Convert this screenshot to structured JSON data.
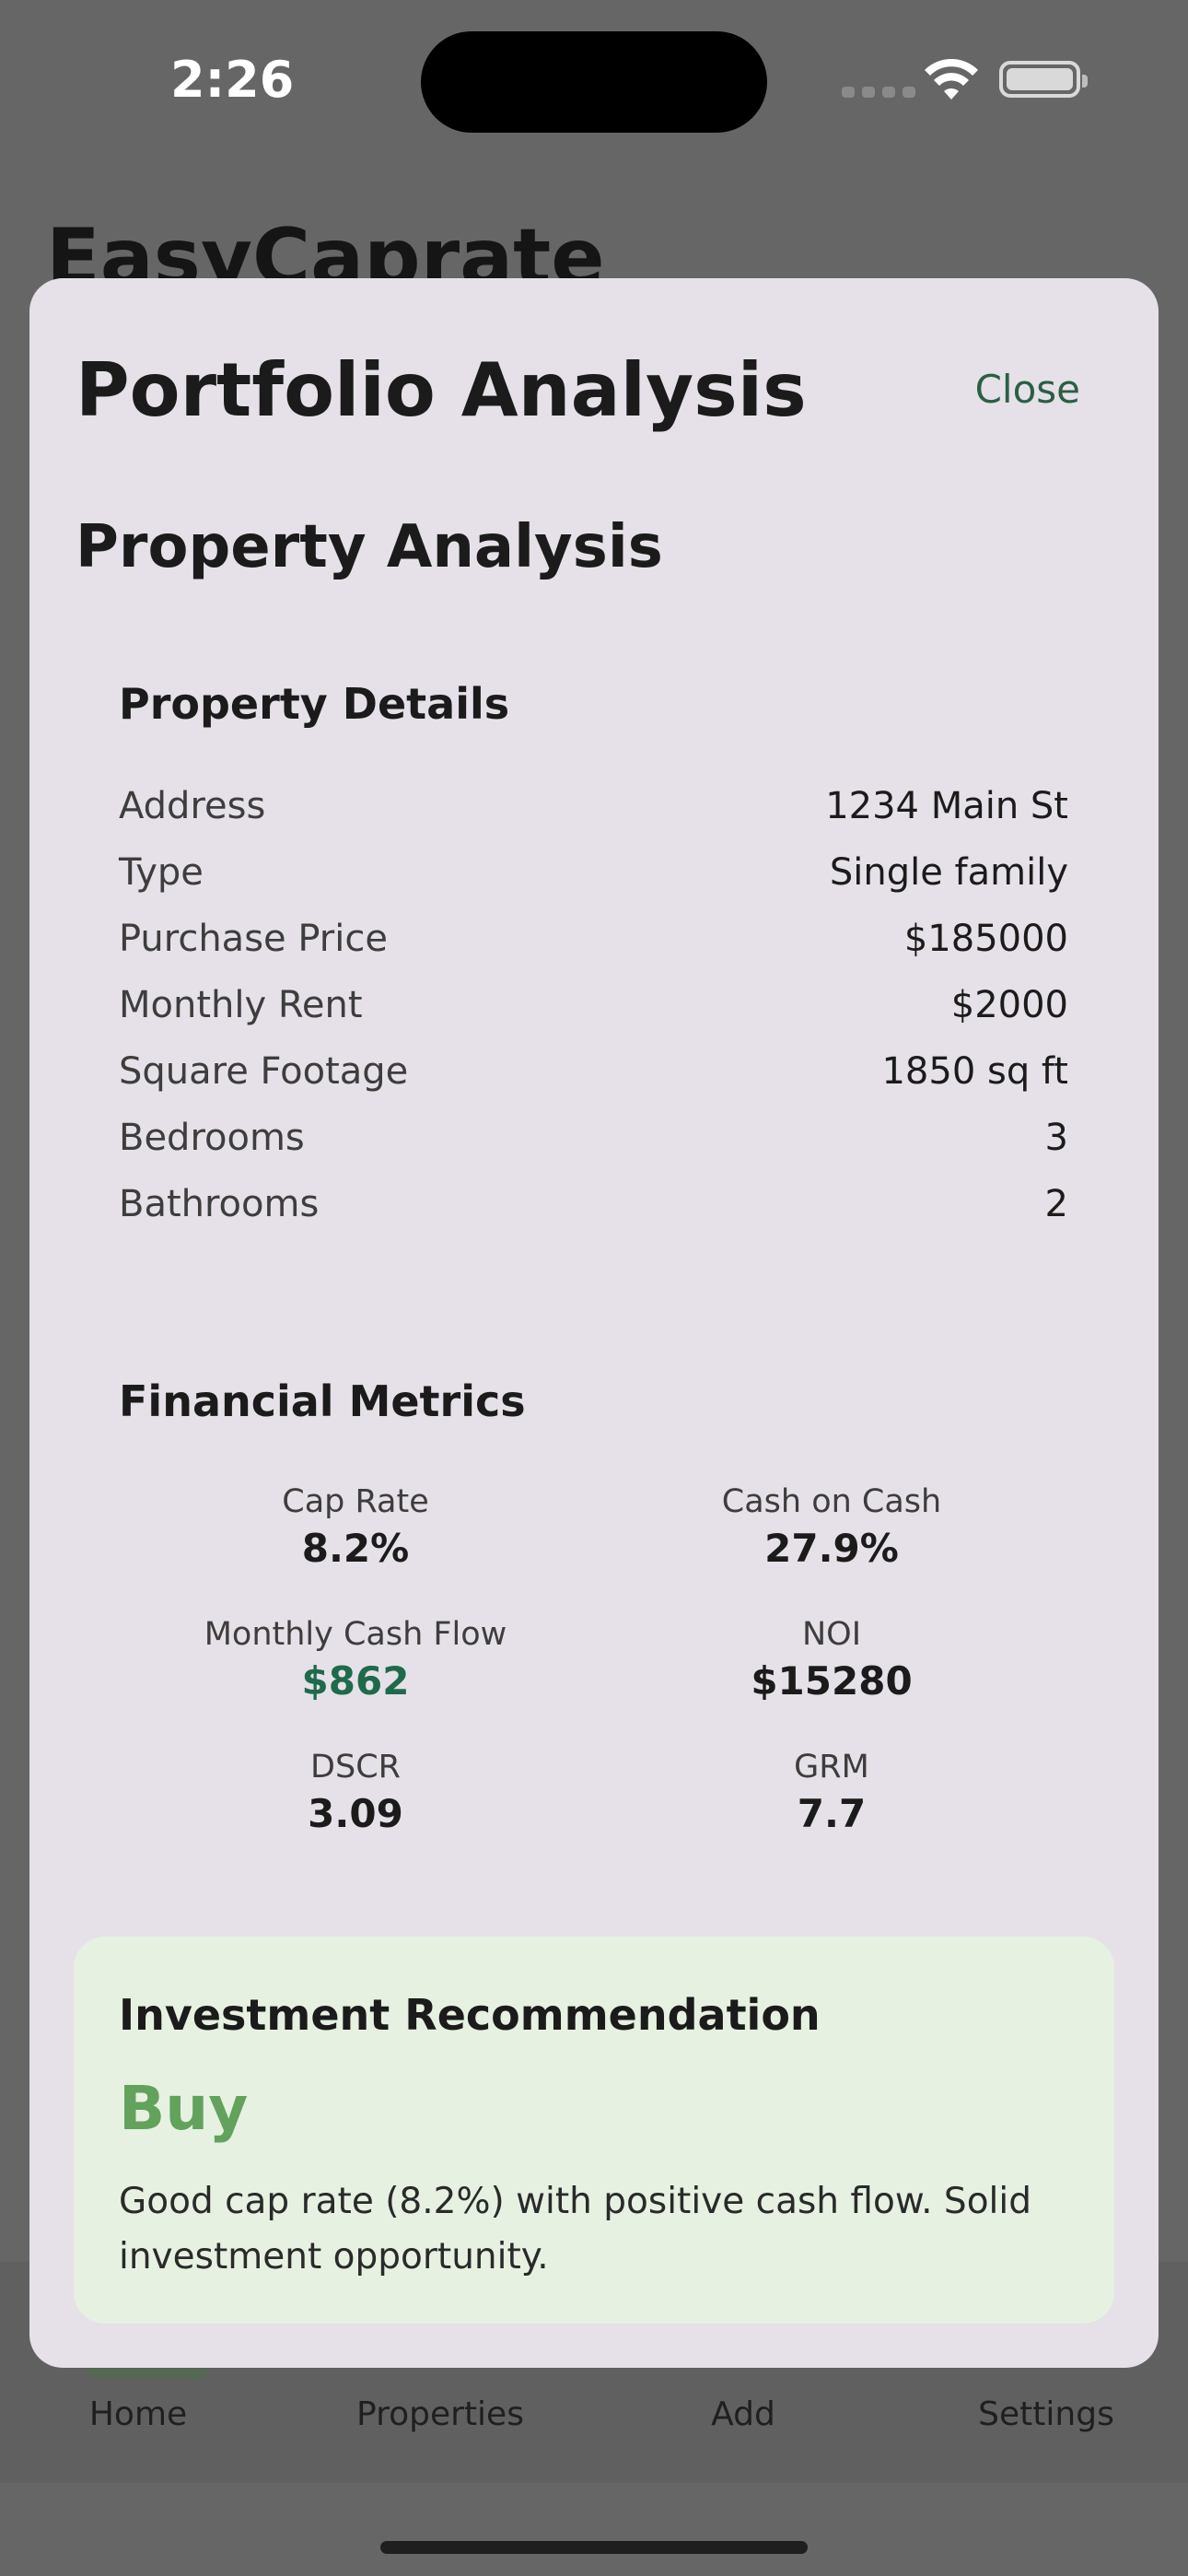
{
  "status_bar": {
    "time": "2:26"
  },
  "background": {
    "app_title": "EasyCaprate",
    "tabs": [
      "Home",
      "Properties",
      "Add",
      "Settings"
    ]
  },
  "modal": {
    "title": "Portfolio Analysis",
    "close_label": "Close",
    "section_title": "Property Analysis",
    "details": {
      "title": "Property Details",
      "rows": [
        {
          "label": "Address",
          "value": "1234 Main St"
        },
        {
          "label": "Type",
          "value": "Single family"
        },
        {
          "label": "Purchase Price",
          "value": "$185000"
        },
        {
          "label": "Monthly Rent",
          "value": "$2000"
        },
        {
          "label": "Square Footage",
          "value": "1850 sq ft"
        },
        {
          "label": "Bedrooms",
          "value": "3"
        },
        {
          "label": "Bathrooms",
          "value": "2"
        }
      ]
    },
    "metrics": {
      "title": "Financial Metrics",
      "items": [
        {
          "label": "Cap Rate",
          "value": "8.2%"
        },
        {
          "label": "Cash on Cash",
          "value": "27.9%"
        },
        {
          "label": "Monthly Cash Flow",
          "value": "$862"
        },
        {
          "label": "NOI",
          "value": "$15280"
        },
        {
          "label": "DSCR",
          "value": "3.09"
        },
        {
          "label": "GRM",
          "value": "7.7"
        }
      ]
    },
    "recommendation": {
      "title": "Investment Recommendation",
      "verdict": "Buy",
      "text": "Good cap rate (8.2%) with positive cash flow. Solid investment opportunity."
    }
  },
  "colors": {
    "positive": "#1f6a4b",
    "verdict": "#62a25c",
    "accent": "#2b5f45"
  }
}
